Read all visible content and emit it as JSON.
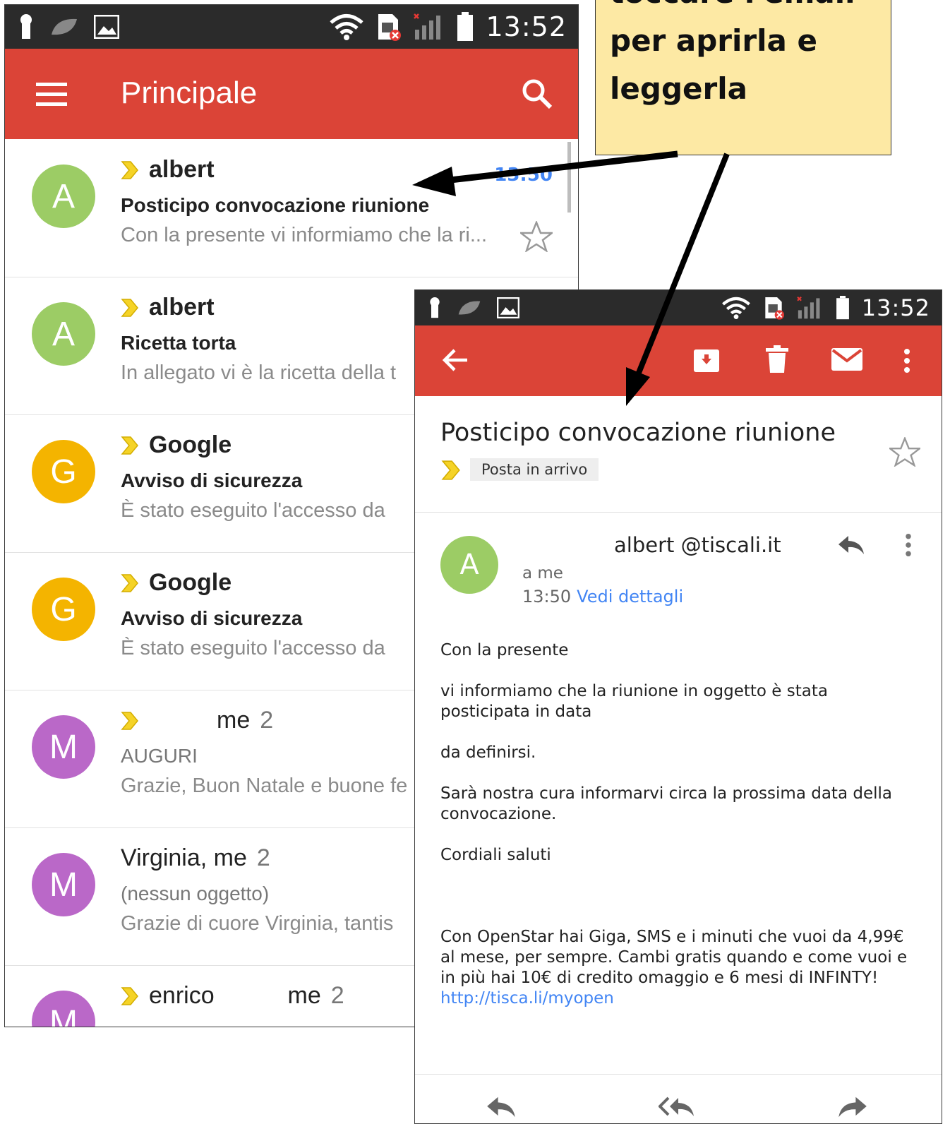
{
  "callout": {
    "lines": [
      "toccare l'email",
      "per aprirla e",
      "leggerla"
    ]
  },
  "inbox": {
    "status_time": "13:52",
    "title": "Principale",
    "items": [
      {
        "avatar_letter": "A",
        "avatar_color": "#9ccc65",
        "sender": "albert",
        "subject": "Posticipo convocazione riunione",
        "snippet": "Con la presente vi informiamo che la ri...",
        "time": "13:50",
        "count": "",
        "unread": true
      },
      {
        "avatar_letter": "A",
        "avatar_color": "#9ccc65",
        "sender": "albert",
        "subject": "Ricetta torta",
        "snippet": "In allegato vi è la ricetta della t",
        "count": "",
        "unread": true
      },
      {
        "avatar_letter": "G",
        "avatar_color": "#f4b400",
        "sender": "Google",
        "subject": "Avviso di sicurezza",
        "snippet": "È stato eseguito l'accesso da",
        "count": "",
        "unread": true
      },
      {
        "avatar_letter": "G",
        "avatar_color": "#f4b400",
        "sender": "Google",
        "subject": "Avviso di sicurezza",
        "snippet": "È stato eseguito l'accesso da",
        "count": "",
        "unread": true
      },
      {
        "avatar_letter": "M",
        "avatar_color": "#ba68c8",
        "sender": "me",
        "subject": "AUGURI",
        "snippet": "Grazie, Buon Natale e buone fe",
        "count": "2",
        "unread": false
      },
      {
        "avatar_letter": "M",
        "avatar_color": "#ba68c8",
        "sender": "Virginia, me",
        "subject": "(nessun oggetto)",
        "snippet": "Grazie di cuore Virginia, tantis",
        "count": "2",
        "unread": false
      },
      {
        "avatar_letter": "M",
        "avatar_color": "#ba68c8",
        "sender": "enrico           me",
        "subject": "",
        "snippet": "",
        "count": "2",
        "unread": false
      }
    ]
  },
  "detail": {
    "status_time": "13:52",
    "subject": "Posticipo convocazione riunione",
    "label": "Posta in arrivo",
    "from_letter": "A",
    "from": "albert @tiscali.it",
    "to": "a me",
    "time": "13:50",
    "details_link": "Vedi dettagli",
    "body": [
      "Con la presente",
      "vi informiamo che la riunione in oggetto è stata posticipata in data",
      "da definirsi.",
      "Sarà nostra cura informarvi circa la prossima data della convocazione.",
      "Cordiali saluti"
    ],
    "ad_text": "Con OpenStar hai Giga, SMS e i minuti che vuoi da 4,99€ al mese, per sempre. Cambi gratis quando e come vuoi e in più hai 10€ di credito omaggio e 6 mesi di INFINTY!",
    "ad_link": "http://tisca.li/myopen"
  },
  "colors": {
    "accent": "#db4437",
    "statusbar": "#2b2b2b",
    "link": "#4285f4",
    "callout": "#fde9a4",
    "important": "#f5d327"
  }
}
